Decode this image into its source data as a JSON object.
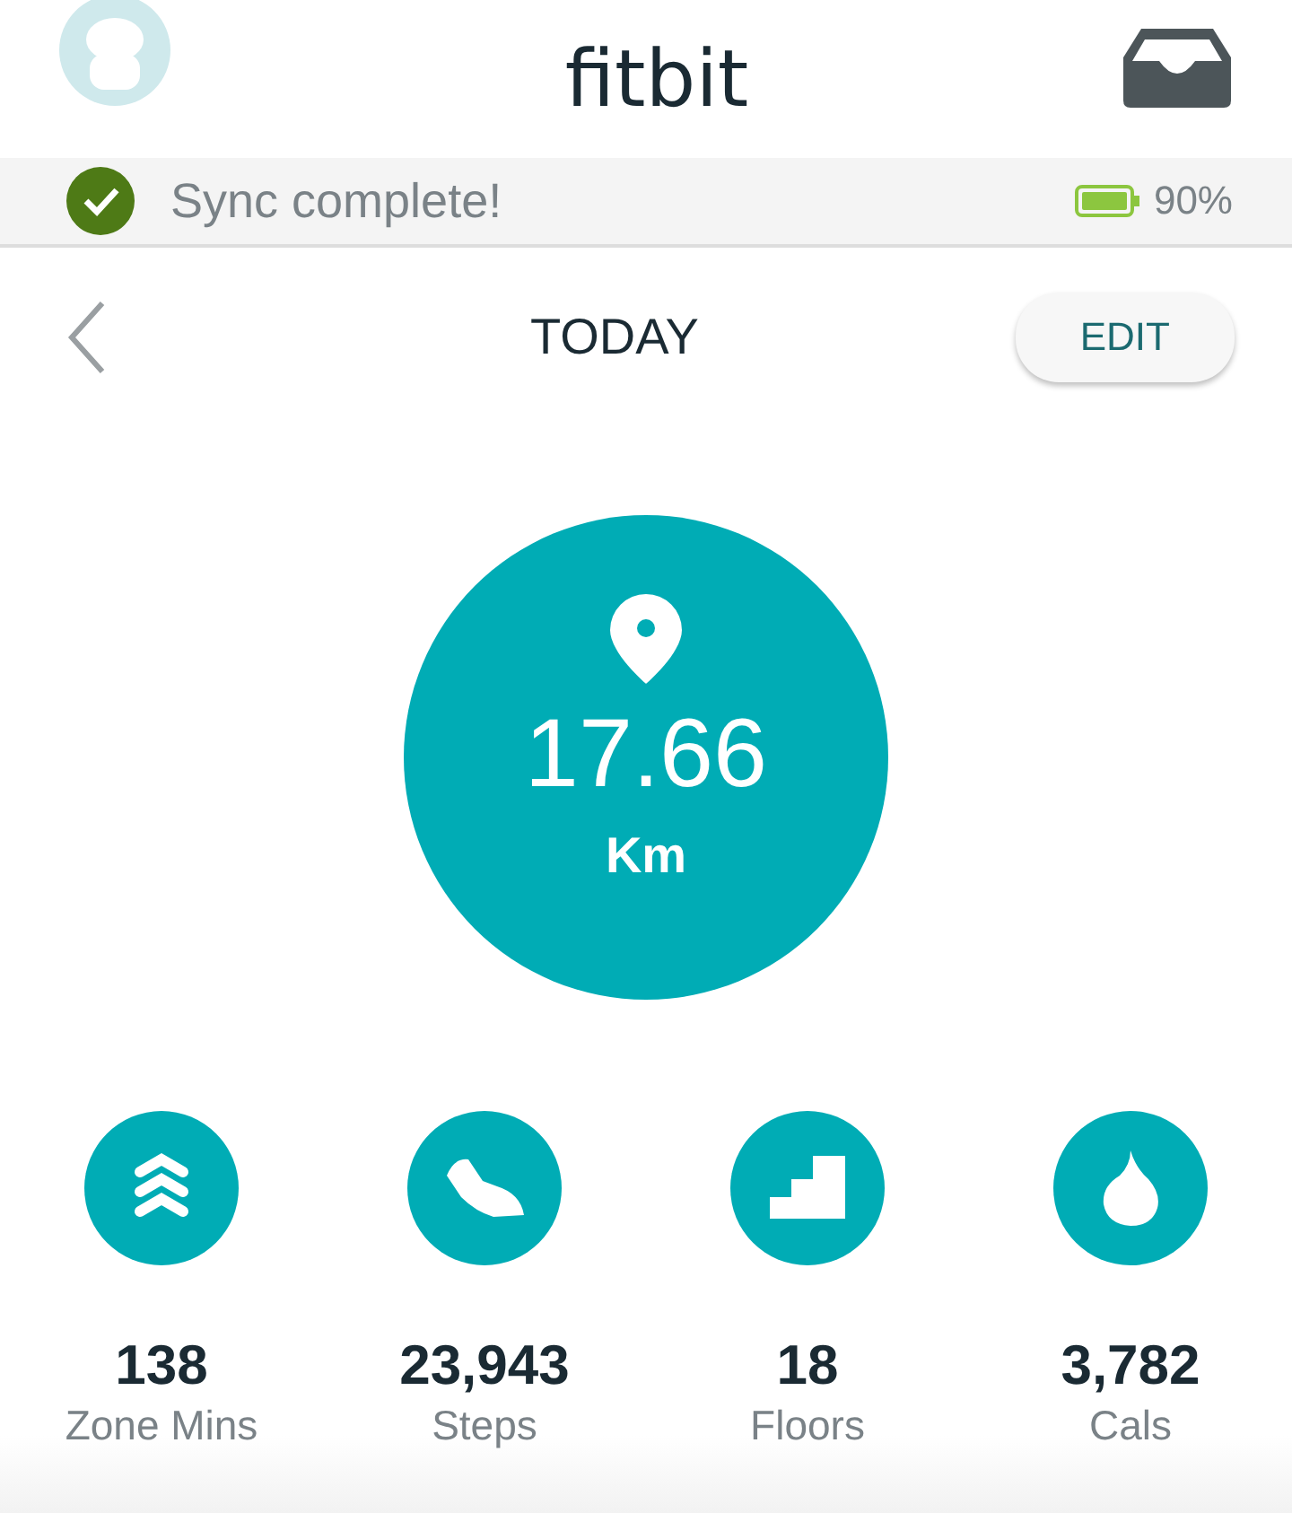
{
  "header": {
    "logo": "fitbit"
  },
  "sync_bar": {
    "message": "Sync complete!",
    "battery": "90%"
  },
  "nav": {
    "title": "TODAY",
    "edit_button": "EDIT"
  },
  "main_stat": {
    "value": "17.66",
    "unit": "Km"
  },
  "stats": [
    {
      "kind": "zone",
      "value": "138",
      "label": "Zone Mins"
    },
    {
      "kind": "steps",
      "value": "23,943",
      "label": "Steps"
    },
    {
      "kind": "floors",
      "value": "18",
      "label": "Floors"
    },
    {
      "kind": "cals",
      "value": "3,782",
      "label": "Cals"
    }
  ]
}
